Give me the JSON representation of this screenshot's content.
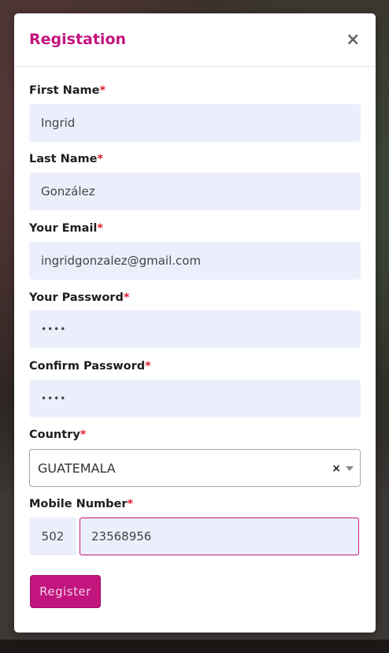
{
  "modal": {
    "title": "Registation",
    "close_glyph": "×"
  },
  "form": {
    "required_marker": "*",
    "first_name": {
      "label": "First Name",
      "value": "Ingrid"
    },
    "last_name": {
      "label": "Last Name",
      "value": "González"
    },
    "email": {
      "label": "Your Email",
      "value": "ingridgonzalez@gmail.com"
    },
    "password": {
      "label": "Your Password",
      "value": "••••"
    },
    "confirm_password": {
      "label": "Confirm Password",
      "value": "••••"
    },
    "country": {
      "label": "Country",
      "selected": "GUATEMALA",
      "clear_glyph": "×"
    },
    "mobile": {
      "label": "Mobile Number",
      "country_code": "502",
      "value": "23568956"
    },
    "submit_label": "Register"
  },
  "colors": {
    "accent": "#c2157e",
    "required": "#e0222f",
    "input_bg": "#ebeffb"
  }
}
